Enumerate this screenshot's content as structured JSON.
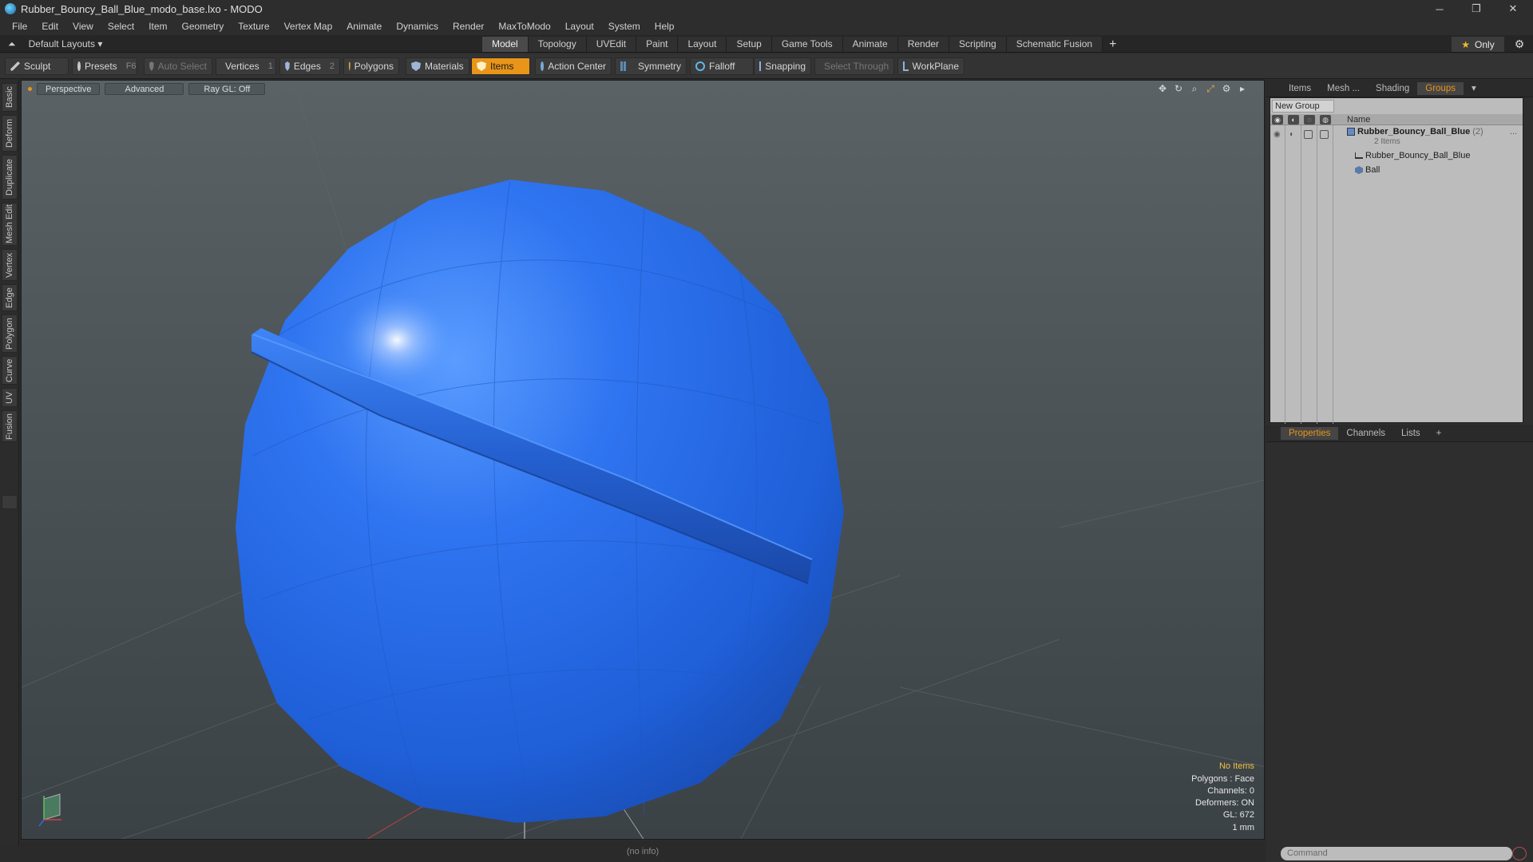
{
  "window": {
    "title": "Rubber_Bouncy_Ball_Blue_modo_base.lxo - MODO",
    "minimize": "─",
    "maximize": "❐",
    "close": "✕"
  },
  "menu": [
    "File",
    "Edit",
    "View",
    "Select",
    "Item",
    "Geometry",
    "Texture",
    "Vertex Map",
    "Animate",
    "Dynamics",
    "Render",
    "MaxToModo",
    "Layout",
    "System",
    "Help"
  ],
  "layout": {
    "dropdown": "Default Layouts ▾",
    "tabs": [
      "Model",
      "Topology",
      "UVEdit",
      "Paint",
      "Layout",
      "Setup",
      "Game Tools",
      "Animate",
      "Render",
      "Scripting",
      "Schematic Fusion"
    ],
    "active_tab": "Model",
    "add": "+",
    "only": "Only",
    "only_star": "★",
    "gear": "⚙"
  },
  "toolbar": {
    "sculpt": "Sculpt",
    "presets": "Presets",
    "presets_key": "F6",
    "auto_select": "Auto Select",
    "vertices": "Vertices",
    "vertices_key": "1",
    "edges": "Edges",
    "edges_key": "2",
    "polygons": "Polygons",
    "materials": "Materials",
    "items": "Items",
    "action_center": "Action Center",
    "symmetry": "Symmetry",
    "falloff": "Falloff",
    "snapping": "Snapping",
    "select_through": "Select Through",
    "workplane": "WorkPlane"
  },
  "left_tabs": [
    "Basic",
    "Deform",
    "Duplicate",
    "Mesh Edit",
    "Vertex",
    "Edge",
    "Polygon",
    "Curve",
    "UV",
    "Fusion"
  ],
  "viewport": {
    "view": "Perspective",
    "shading": "Advanced",
    "raygl": "Ray GL: Off",
    "info": {
      "selection": "No Items",
      "polygons": "Polygons : Face",
      "channels": "Channels: 0",
      "deformers": "Deformers: ON",
      "gl": "GL: 672",
      "unit": "1 mm"
    },
    "ball_color": "#2a6ee8"
  },
  "status": "(no info)",
  "right_panel": {
    "tabs": [
      "Items",
      "Mesh ...",
      "Shading",
      "Groups"
    ],
    "active_tab": "Groups",
    "new_group": "New Group",
    "col_name": "Name",
    "group": {
      "name": "Rubber_Bouncy_Ball_Blue",
      "count": "(2)",
      "sub": "2 Items",
      "more": "..."
    },
    "children": [
      "Rubber_Bouncy_Ball_Blue",
      "Ball"
    ],
    "lower_tabs": [
      "Properties",
      "Channels",
      "Lists"
    ],
    "lower_active": "Properties",
    "lower_add": "+",
    "command_placeholder": "Command"
  },
  "colors": {
    "accent": "#e8951a",
    "panel": "#2e2e2e"
  }
}
